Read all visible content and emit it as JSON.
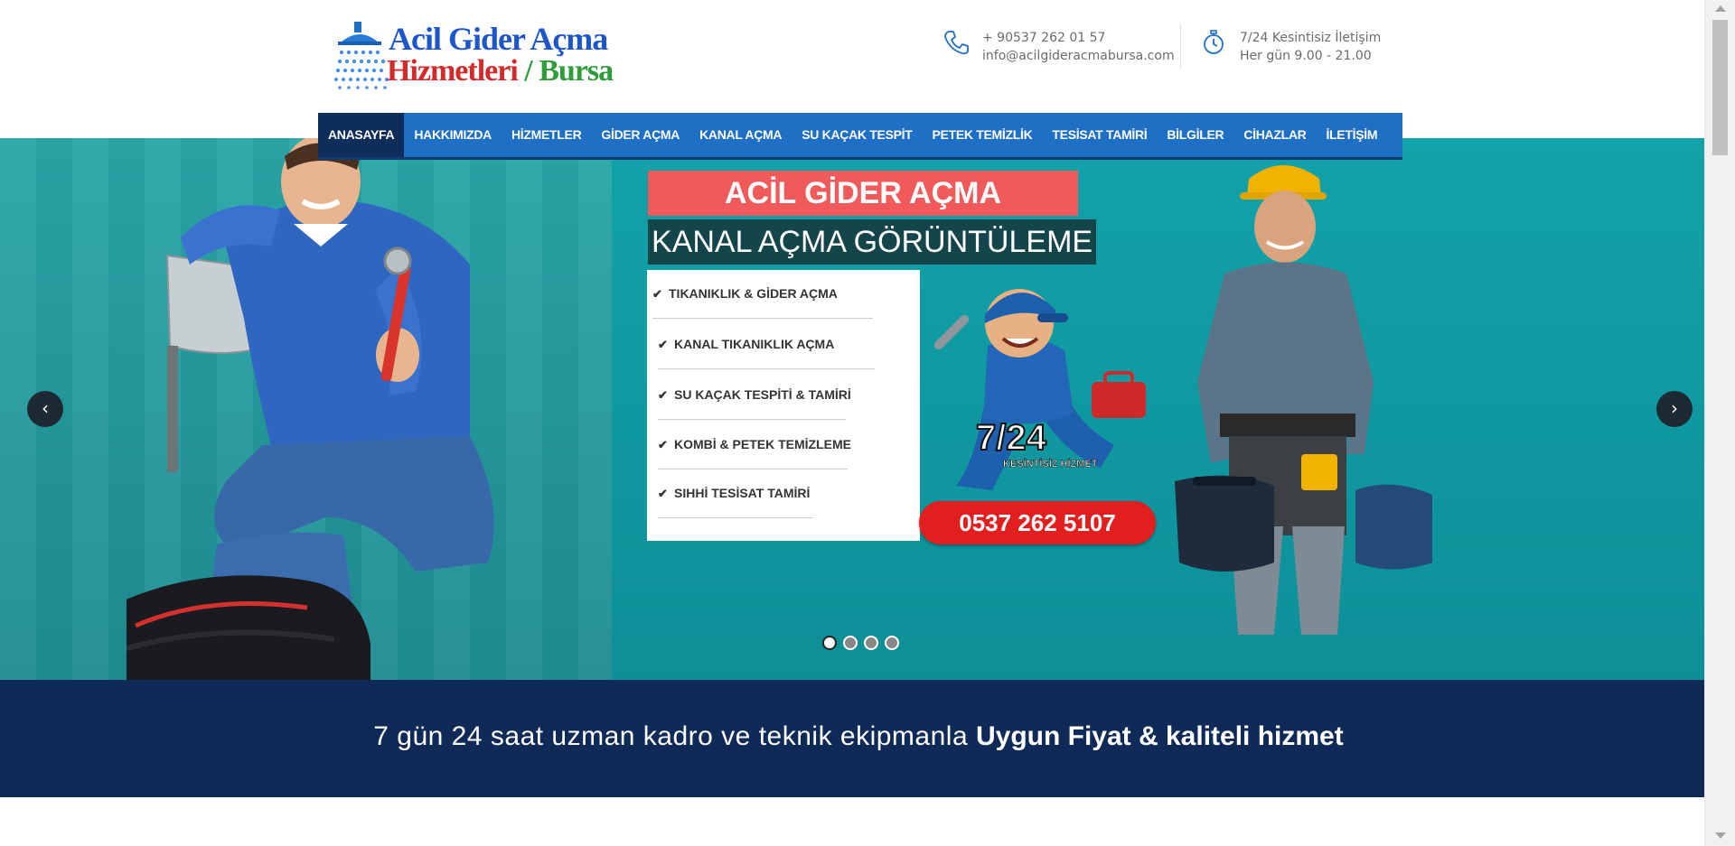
{
  "logo": {
    "line1": "Acil Gider Açma",
    "line2_a": "Hizmetleri",
    "line2_b": "/ Bursa"
  },
  "contact": {
    "phone": "+ 90537 262 01 57",
    "email": "info@acilgideracmabursa.com",
    "hours_title": "7/24 Kesintisiz İletişim",
    "hours_text": "Her gün 9.00 - 21.00"
  },
  "nav": {
    "items": [
      "ANASAYFA",
      "HAKKIMIZDA",
      "HİZMETLER",
      "GİDER AÇMA",
      "KANAL AÇMA",
      "SU KAÇAK TESPİT",
      "PETEK TEMİZLİK",
      "TESİSAT TAMİRİ",
      "BİLGİLER",
      "CİHAZLAR",
      "İLETİŞİM"
    ]
  },
  "slider": {
    "headline1": "ACİL GİDER AÇMA",
    "headline2": "KANAL AÇMA GÖRÜNTÜLEME",
    "services": [
      "TIKANIKLIK & GİDER AÇMA",
      "KANAL TIKANIKLIK AÇMA",
      "SU KAÇAK TESPİTİ & TAMİRİ",
      "KOMBİ & PETEK TEMİZLEME",
      "SIHHİ TESİSAT TAMİRİ"
    ],
    "badge_main": "7/24",
    "badge_sub": "KESİNTİSİZ HİZMET",
    "phone": "0537 262 5107",
    "prev": "‹",
    "next": "›",
    "dots": 4,
    "active_dot": 0
  },
  "banner": {
    "light": "7 gün 24 saat uzman kadro ve teknik ekipmanla ",
    "bold": "Uygun Fiyat & kaliteli hizmet"
  },
  "colors": {
    "nav": "#1f6fc4",
    "nav_active": "#0f2d5a",
    "slider": "#13a0a8",
    "headline_red": "#f15a5a",
    "headline_dark": "#14454a",
    "phone_red": "#e21f1f",
    "banner": "#0f2a57"
  }
}
